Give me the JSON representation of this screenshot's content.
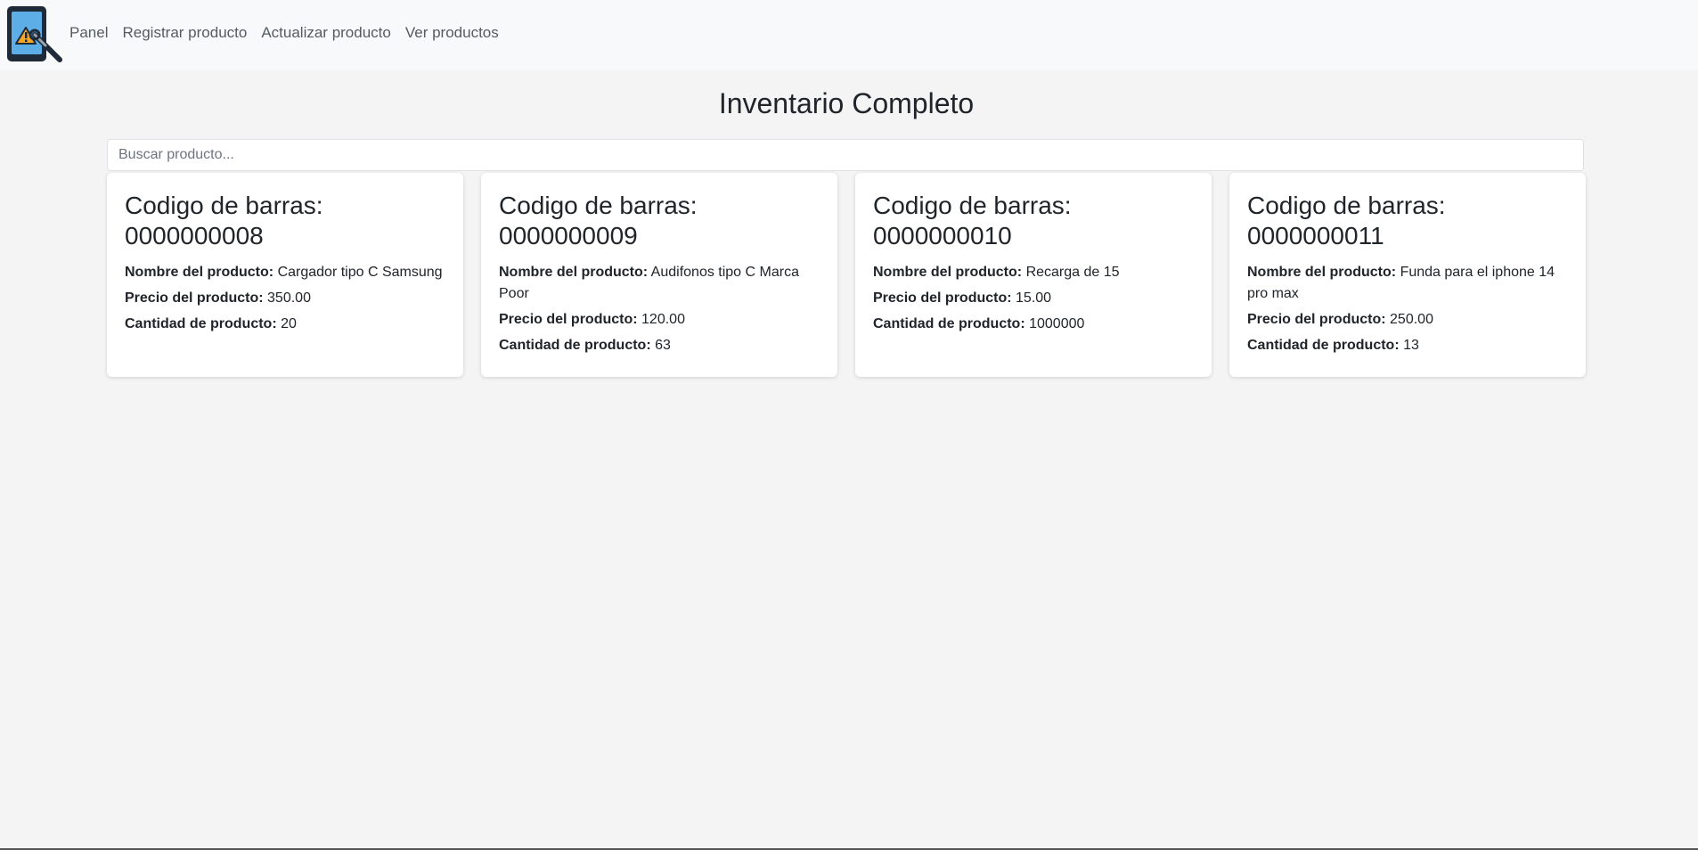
{
  "nav": {
    "links": [
      "Panel",
      "Registrar producto",
      "Actualizar producto",
      "Ver productos"
    ]
  },
  "page": {
    "title": "Inventario Completo"
  },
  "search": {
    "placeholder": "Buscar producto...",
    "value": ""
  },
  "labels": {
    "barcode_prefix": "Codigo de barras:",
    "name": "Nombre del producto:",
    "price": "Precio del producto:",
    "quantity": "Cantidad de producto:"
  },
  "products": [
    {
      "barcode": "0000000008",
      "name": "Cargador tipo C Samsung",
      "price": "350.00",
      "quantity": "20"
    },
    {
      "barcode": "0000000009",
      "name": "Audifonos tipo C Marca Poor",
      "price": "120.00",
      "quantity": "63"
    },
    {
      "barcode": "0000000010",
      "name": "Recarga de 15",
      "price": "15.00",
      "quantity": "1000000"
    },
    {
      "barcode": "0000000011",
      "name": "Funda para el iphone 14 pro max",
      "price": "250.00",
      "quantity": "13"
    }
  ],
  "colors": {
    "navbar_bg": "#f8f9fa",
    "page_bg": "#f4f4f4",
    "card_bg": "#ffffff",
    "logo_frame": "#1e2a38",
    "logo_screen": "#4fa3e0",
    "logo_warning": "#f5a623"
  },
  "icons": {
    "logo": "phone-repair-warning-icon"
  }
}
